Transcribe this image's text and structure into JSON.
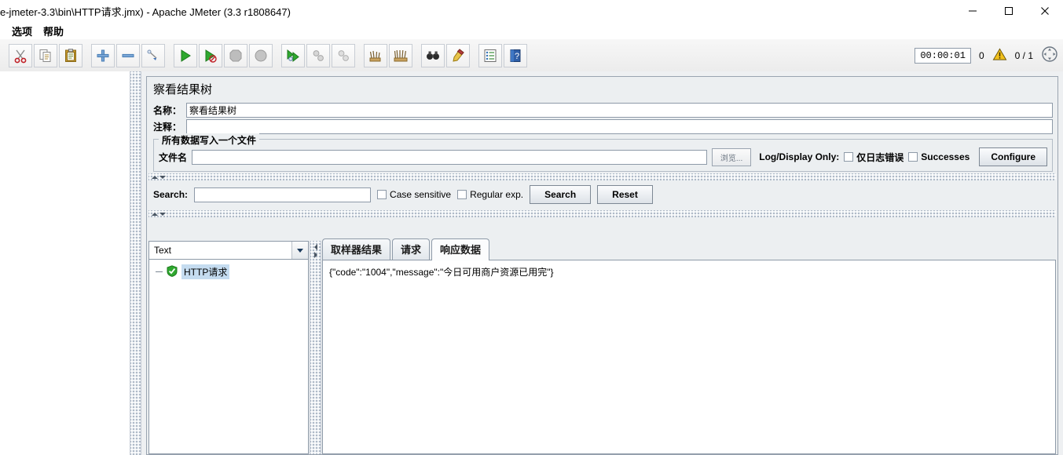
{
  "window": {
    "title": "e-jmeter-3.3\\bin\\HTTP请求.jmx) - Apache JMeter (3.3 r1808647)",
    "minimize_label": "minimize",
    "maximize_label": "maximize",
    "close_label": "close"
  },
  "menubar": {
    "items": [
      {
        "label": "选项",
        "name": "menu-options"
      },
      {
        "label": "帮助",
        "name": "menu-help"
      }
    ]
  },
  "toolbar": {
    "buttons": [
      {
        "name": "cut-icon",
        "title": "剪切"
      },
      {
        "name": "copy-icon",
        "title": "复制"
      },
      {
        "name": "paste-icon",
        "title": "粘贴"
      },
      {
        "name": "expand-all-icon",
        "title": "展开全部"
      },
      {
        "name": "collapse-all-icon",
        "title": "收起全部"
      },
      {
        "name": "toggle-icon",
        "title": "切换"
      },
      {
        "name": "start-icon",
        "title": "启动"
      },
      {
        "name": "start-no-pauses-icon",
        "title": "无暂停启动"
      },
      {
        "name": "stop-icon",
        "title": "停止"
      },
      {
        "name": "shutdown-icon",
        "title": "关闭"
      },
      {
        "name": "remote-start-all-icon",
        "title": "远程全部启动"
      },
      {
        "name": "remote-stop-all-icon",
        "title": "远程全部停止"
      },
      {
        "name": "remote-shutdown-all-icon",
        "title": "远程全部关闭"
      },
      {
        "name": "clear-icon",
        "title": "清除"
      },
      {
        "name": "clear-all-icon",
        "title": "清除全部"
      },
      {
        "name": "search-icon",
        "title": "搜索"
      },
      {
        "name": "search-reset-icon",
        "title": "重置搜索"
      },
      {
        "name": "function-helper-icon",
        "title": "函数助手对话框"
      },
      {
        "name": "help-icon",
        "title": "帮助"
      }
    ],
    "status": {
      "timer": "00:00:01",
      "warning_count": "0",
      "warning_icon": "warning-triangle-icon",
      "thread_count": "0 / 1",
      "expand_icon": "expand-circle-icon"
    }
  },
  "panel": {
    "title": "察看结果树",
    "name_label": "名称：",
    "name_value": "察看结果树",
    "comment_label": "注释：",
    "comment_value": "",
    "filegroup": {
      "title": "所有数据写入一个文件",
      "filename_label": "文件名",
      "filename_value": "",
      "browse_label": "浏览...",
      "logdisplay_label": "Log/Display Only:",
      "errors_only_label": "仅日志错误",
      "successes_label": "Successes",
      "configure_label": "Configure"
    },
    "search": {
      "label": "Search:",
      "value": "",
      "case_sensitive_label": "Case sensitive",
      "regular_exp_label": "Regular exp.",
      "search_button": "Search",
      "reset_button": "Reset"
    },
    "results": {
      "render_selected": "Text",
      "tree_node_label": "HTTP请求",
      "tree_node_status_icon": "success-shield-icon",
      "tabs": [
        {
          "label": "取样器结果",
          "active": false
        },
        {
          "label": "请求",
          "active": false
        },
        {
          "label": "响应数据",
          "active": true
        }
      ],
      "response_data": "{\"code\":\"1004\",\"message\":\"今日可用商户资源已用完\"}"
    }
  }
}
